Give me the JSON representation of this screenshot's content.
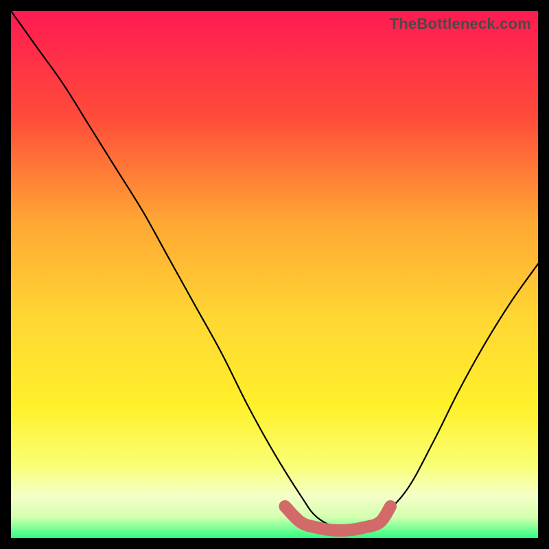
{
  "watermark": {
    "text": "TheBottleneck.com"
  },
  "colors": {
    "frame_bg": "#000000",
    "curve_stroke": "#000000",
    "marker_stroke": "#d26a6a",
    "marker_fill": "none",
    "gradient_stops": [
      {
        "offset": 0.0,
        "color": "#ff1a52"
      },
      {
        "offset": 0.2,
        "color": "#ff4b3a"
      },
      {
        "offset": 0.4,
        "color": "#ffa733"
      },
      {
        "offset": 0.58,
        "color": "#ffd633"
      },
      {
        "offset": 0.75,
        "color": "#fff02a"
      },
      {
        "offset": 0.86,
        "color": "#f9ff73"
      },
      {
        "offset": 0.92,
        "color": "#f5ffc8"
      },
      {
        "offset": 0.96,
        "color": "#d4ffb0"
      },
      {
        "offset": 1.0,
        "color": "#2fff82"
      }
    ]
  },
  "chart_data": {
    "type": "line",
    "title": "",
    "xlabel": "",
    "ylabel": "",
    "xlim": [
      0,
      100
    ],
    "ylim": [
      0,
      100
    ],
    "grid": false,
    "series": [
      {
        "name": "bottleneck-curve",
        "x": [
          0,
          5,
          10,
          15,
          20,
          25,
          30,
          35,
          40,
          45,
          50,
          55,
          58,
          62,
          66,
          70,
          75,
          80,
          85,
          90,
          95,
          100
        ],
        "y": [
          100,
          93,
          86,
          78,
          70,
          62,
          53,
          44,
          35,
          25,
          16,
          8,
          4,
          2,
          2,
          4,
          9,
          18,
          28,
          37,
          45,
          52
        ]
      },
      {
        "name": "optimal-range-marker",
        "x": [
          52,
          55,
          58,
          61,
          64,
          67,
          70,
          72
        ],
        "y": [
          6,
          3,
          2,
          1.5,
          1.5,
          2,
          3,
          6
        ]
      }
    ],
    "annotations": []
  }
}
